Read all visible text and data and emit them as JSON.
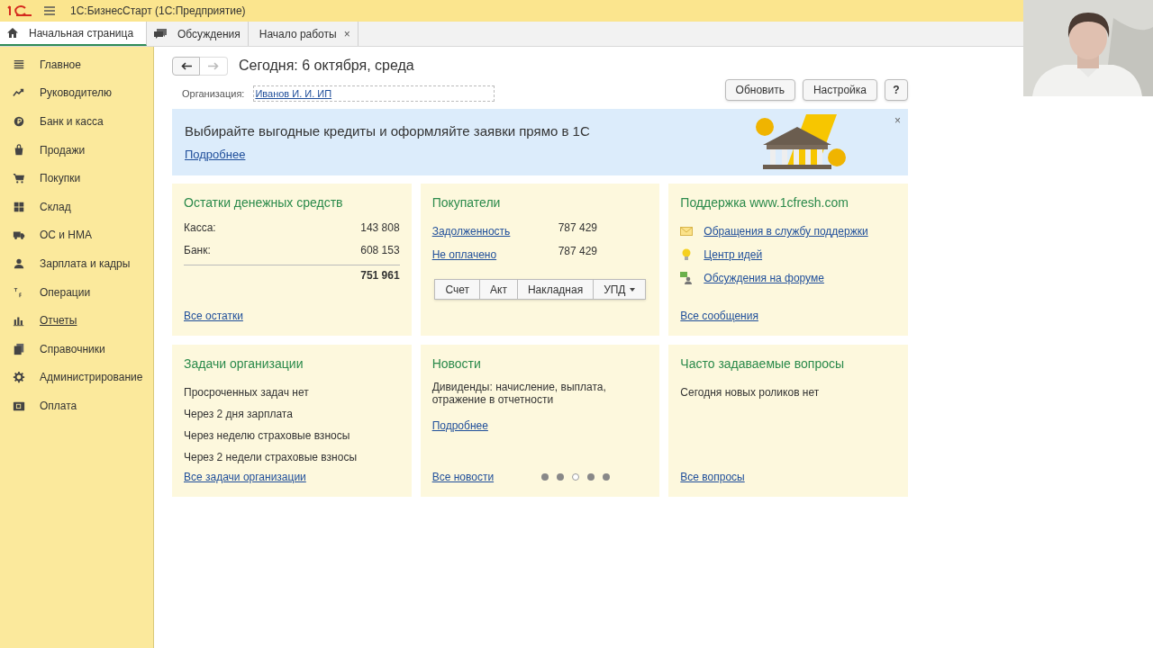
{
  "window": {
    "title": "1С:БизнесСтарт  (1С:Предприятие)"
  },
  "tabs": [
    {
      "label": "Начальная страница",
      "selected": true,
      "kind": "home"
    },
    {
      "label": "Обсуждения",
      "selected": false,
      "kind": "chat"
    },
    {
      "label": "Начало работы",
      "selected": false,
      "kind": "closable",
      "close": "×"
    }
  ],
  "sidebar": {
    "items": [
      {
        "label": "Главное",
        "hovered": false
      },
      {
        "label": "Руководителю",
        "hovered": false
      },
      {
        "label": "Банк и касса",
        "hovered": false
      },
      {
        "label": "Продажи",
        "hovered": false
      },
      {
        "label": "Покупки",
        "hovered": false
      },
      {
        "label": "Склад",
        "hovered": false
      },
      {
        "label": "ОС и НМА",
        "hovered": false
      },
      {
        "label": "Зарплата и кадры",
        "hovered": false
      },
      {
        "label": "Операции",
        "hovered": false
      },
      {
        "label": "Отчеты",
        "hovered": true
      },
      {
        "label": "Справочники",
        "hovered": false
      },
      {
        "label": "Администрирование",
        "hovered": false
      },
      {
        "label": "Оплата",
        "hovered": false
      }
    ]
  },
  "header": {
    "title": "Сегодня: 6 октября, среда",
    "back_enabled": true,
    "forward_enabled": false
  },
  "organization": {
    "label": "Организация:",
    "value": "Иванов И. И. ИП"
  },
  "buttons": [
    "Обновить",
    "Настройка",
    "?"
  ],
  "banner": {
    "text": "Выбирайте выгодные кредиты и оформляйте заявки прямо в 1С",
    "link": "Подробнее",
    "close": "×"
  },
  "cards": [
    {
      "kind": "balances",
      "title": "Остатки денежных средств",
      "rows": [
        {
          "label": "Касса:",
          "value": "143 808"
        },
        {
          "label": "Банк:",
          "value": "608 153"
        }
      ],
      "total": "751 961",
      "link": "Все остатки"
    },
    {
      "kind": "customers",
      "title": "Покупатели",
      "rows": [
        {
          "label": "Задолженность",
          "value": "787 429"
        },
        {
          "label": "Не оплачено",
          "value": "787 429"
        }
      ],
      "actions": [
        "Счет",
        "Акт",
        "Накладная",
        "УПД"
      ]
    },
    {
      "kind": "support",
      "title": "Поддержка www.1cfresh.com",
      "items": [
        "Обращения в службу поддержки",
        "Центр идей",
        "Обсуждения на форуме"
      ],
      "link": "Все сообщения"
    },
    {
      "kind": "tasks",
      "title": "Задачи организации",
      "lines": [
        "Просроченных задач нет",
        "Через 2 дня зарплата",
        "Через неделю страховые взносы",
        "Через 2 недели страховые взносы"
      ],
      "link": "Все задачи организации"
    },
    {
      "kind": "news",
      "title": "Новости",
      "text": "Дивиденды: начисление, выплата, отражение в отчетности",
      "more": "Подробнее",
      "link": "Все новости",
      "dots": [
        {
          "selected": false
        },
        {
          "selected": false
        },
        {
          "selected": true
        },
        {
          "selected": false
        },
        {
          "selected": false
        }
      ]
    },
    {
      "kind": "faq",
      "title": "Часто задаваемые вопросы",
      "lines": [
        "Сегодня новых роликов нет"
      ],
      "link": "Все вопросы"
    }
  ],
  "webcam": {
    "kind": "picture"
  }
}
